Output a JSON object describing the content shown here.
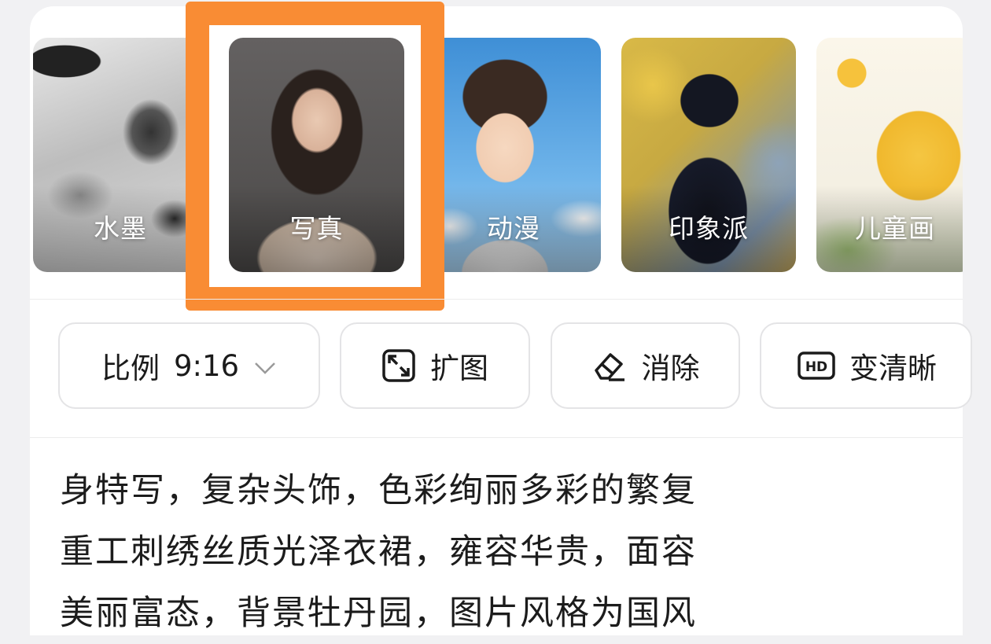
{
  "styles": [
    {
      "label": "水墨"
    },
    {
      "label": "写真"
    },
    {
      "label": "动漫"
    },
    {
      "label": "印象派"
    },
    {
      "label": "儿童画"
    }
  ],
  "selected_style": "写真",
  "highlight_color": "#f98c34",
  "tools": {
    "ratio_label": "比例",
    "ratio_value": "9:16",
    "expand_label": "扩图",
    "erase_label": "消除",
    "hd_label": "变清晰",
    "hd_badge": "HD"
  },
  "prompt_lines": [
    "身特写，复杂头饰，色彩绚丽多彩的繁复",
    "重工刺绣丝质光泽衣裙，雍容华贵，面容",
    "美丽富态，背景牡丹园，图片风格为国风"
  ]
}
